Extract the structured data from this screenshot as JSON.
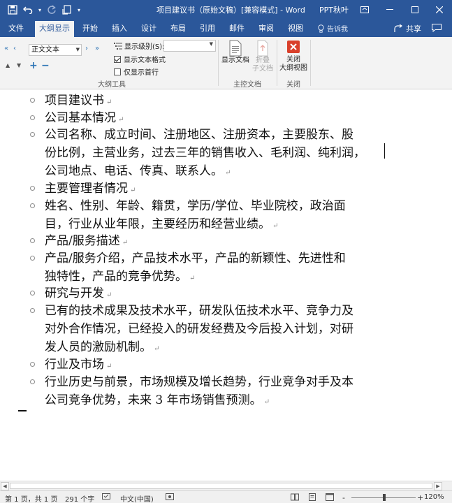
{
  "window": {
    "title": "项目建议书（原始文稿）[兼容模式] - Word",
    "user": "PPT秋叶"
  },
  "ribbon": {
    "tabs": [
      {
        "label": "文件",
        "active": false
      },
      {
        "label": "大纲显示",
        "active": true
      },
      {
        "label": "开始",
        "active": false
      },
      {
        "label": "插入",
        "active": false
      },
      {
        "label": "设计",
        "active": false
      },
      {
        "label": "布局",
        "active": false
      },
      {
        "label": "引用",
        "active": false
      },
      {
        "label": "邮件",
        "active": false
      },
      {
        "label": "审阅",
        "active": false
      },
      {
        "label": "视图",
        "active": false
      }
    ],
    "tell_me": "告诉我",
    "share": "共享",
    "outline_tools": {
      "level_value": "正文文本",
      "show_level_label": "显示级别(S):",
      "show_level_value": "",
      "show_text_formatting": {
        "label": "显示文本格式",
        "checked": true
      },
      "show_first_line_only": {
        "label": "仅显示首行",
        "checked": false
      },
      "group_label": "大纲工具"
    },
    "master_document": {
      "show_document": "显示文档",
      "collapse_line1": "折叠",
      "collapse_line2": "子文档",
      "group_label": "主控文档"
    },
    "close": {
      "line1": "关闭",
      "line2": "大纲视图",
      "group_label": "关闭"
    }
  },
  "document": {
    "items": [
      {
        "text": "项目建议书"
      },
      {
        "text": "公司基本情况"
      },
      {
        "lines": [
          "公司名称、成立时间、注册地区、注册资本，主要股东、股",
          "份比例，主营业务，过去三年的销售收入、毛利润、纯利润，",
          "公司地点、电话、传真、联系人。"
        ]
      },
      {
        "text": "主要管理者情况"
      },
      {
        "lines": [
          "姓名、性别、年龄、籍贯，学历/学位、毕业院校，政治面",
          "目，行业从业年限，主要经历和经营业绩。"
        ]
      },
      {
        "text": "产品/服务描述"
      },
      {
        "lines": [
          "产品/服务介绍，产品技术水平，产品的新颖性、先进性和",
          "独特性，产品的竞争优势。"
        ]
      },
      {
        "text": "研究与开发"
      },
      {
        "lines": [
          "已有的技术成果及技术水平，研发队伍技术水平、竞争力及",
          "对外合作情况，已经投入的研发经费及今后投入计划，对研",
          "发人员的激励机制。"
        ]
      },
      {
        "text": "行业及市场"
      },
      {
        "lines": [
          "行业历史与前景，市场规模及增长趋势，行业竞争对手及本",
          "公司竞争优势，未来 3 年市场销售预测。"
        ]
      }
    ]
  },
  "statusbar": {
    "page": "第 1 页，共 1 页",
    "words": "291 个字",
    "language": "中文(中国)",
    "zoom": "120%",
    "zoom_minus": "-",
    "zoom_plus": "+"
  },
  "colors": {
    "accent": "#2b579a",
    "close_red": "#d9402b"
  }
}
